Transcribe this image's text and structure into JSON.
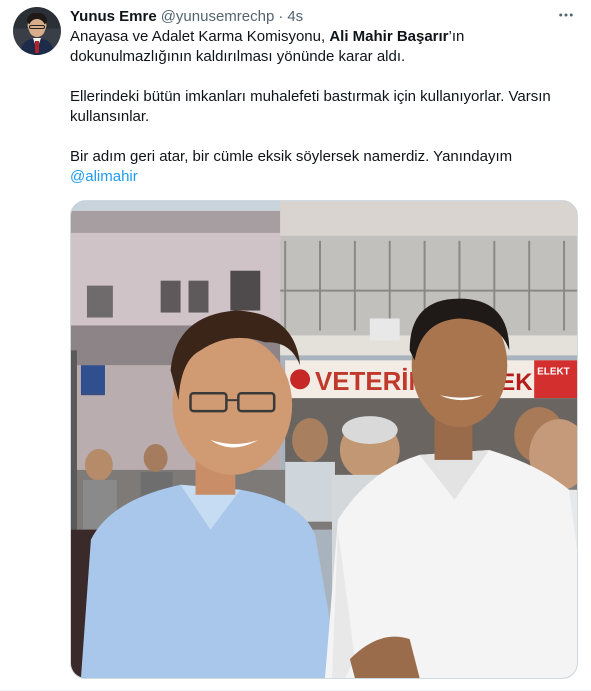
{
  "tweet": {
    "author_name": "Yunus Emre",
    "author_handle": "@yunusemrechp",
    "separator": "·",
    "time": "4s",
    "line1_pre": "Anayasa ve Adalet Karma Komisyonu, ",
    "line1_bold": "Ali Mahir Başarır",
    "line1_post": "’ın dokunulmazlığının kaldırılması yönünde karar aldı.",
    "para2": "Ellerindeki bütün imkanları muhalefeti bastırmak için kullanıyorlar. Varsın kullansınlar.",
    "para3": "Bir adım geri atar, bir cümle eksik söylersek namerdiz. Yanındayım",
    "mention": "@alimahir"
  },
  "media": {
    "shop_sign": "VETERİN",
    "shop_sign2": "EK",
    "shop_sign3": "ELEKT"
  },
  "icons": {
    "more": "more-horizontal-icon",
    "avatar": "avatar"
  }
}
